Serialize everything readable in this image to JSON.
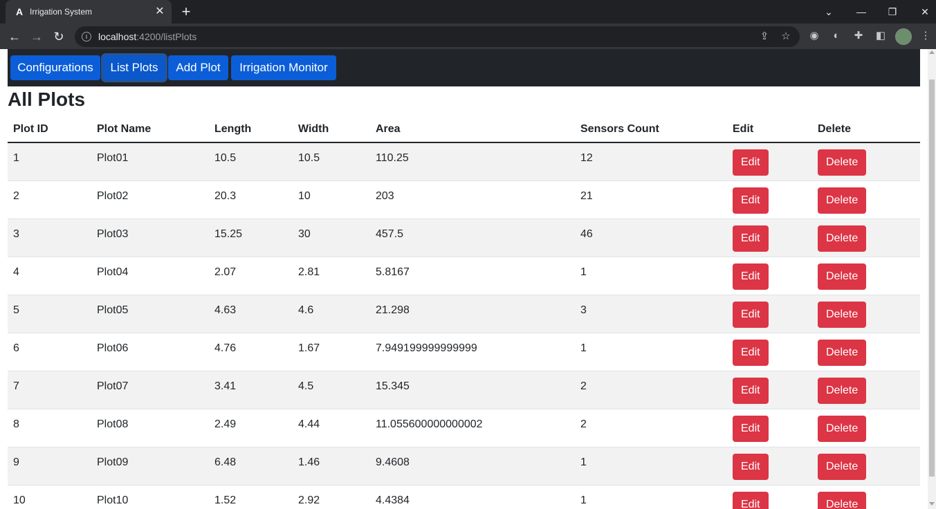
{
  "browser": {
    "tab_title": "Irrigation System",
    "tab_favicon": "angular-icon",
    "url_host": "localhost",
    "url_rest": ":4200/listPlots"
  },
  "nav": {
    "items": [
      {
        "label": "Configurations"
      },
      {
        "label": "List Plots",
        "active": true
      },
      {
        "label": "Add Plot"
      },
      {
        "label": "Irrigation Monitor"
      }
    ]
  },
  "page": {
    "title": "All Plots"
  },
  "table": {
    "headers": [
      "Plot ID",
      "Plot Name",
      "Length",
      "Width",
      "Area",
      "Sensors Count",
      "Edit",
      "Delete"
    ],
    "rows": [
      {
        "id": "1",
        "name": "Plot01",
        "length": "10.5",
        "width": "10.5",
        "area": "110.25",
        "sensors": "12"
      },
      {
        "id": "2",
        "name": "Plot02",
        "length": "20.3",
        "width": "10",
        "area": "203",
        "sensors": "21"
      },
      {
        "id": "3",
        "name": "Plot03",
        "length": "15.25",
        "width": "30",
        "area": "457.5",
        "sensors": "46"
      },
      {
        "id": "4",
        "name": "Plot04",
        "length": "2.07",
        "width": "2.81",
        "area": "5.8167",
        "sensors": "1"
      },
      {
        "id": "5",
        "name": "Plot05",
        "length": "4.63",
        "width": "4.6",
        "area": "21.298",
        "sensors": "3"
      },
      {
        "id": "6",
        "name": "Plot06",
        "length": "4.76",
        "width": "1.67",
        "area": "7.949199999999999",
        "sensors": "1"
      },
      {
        "id": "7",
        "name": "Plot07",
        "length": "3.41",
        "width": "4.5",
        "area": "15.345",
        "sensors": "2"
      },
      {
        "id": "8",
        "name": "Plot08",
        "length": "2.49",
        "width": "4.44",
        "area": "11.055600000000002",
        "sensors": "2"
      },
      {
        "id": "9",
        "name": "Plot09",
        "length": "6.48",
        "width": "1.46",
        "area": "9.4608",
        "sensors": "1"
      },
      {
        "id": "10",
        "name": "Plot10",
        "length": "1.52",
        "width": "2.92",
        "area": "4.4384",
        "sensors": "1"
      }
    ],
    "edit_label": "Edit",
    "delete_label": "Delete"
  },
  "colors": {
    "nav_bg": "#212529",
    "nav_button": "#0b5ed7",
    "danger": "#dc3545",
    "stripe": "#f2f2f2"
  }
}
